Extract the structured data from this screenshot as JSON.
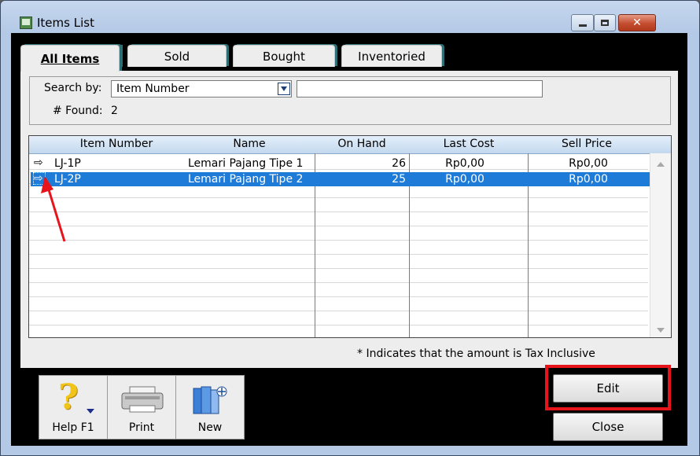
{
  "window": {
    "title": "Items List"
  },
  "tabs": [
    {
      "label": "All Items",
      "active": true
    },
    {
      "label": "Sold"
    },
    {
      "label": "Bought"
    },
    {
      "label": "Inventoried"
    }
  ],
  "search": {
    "label": "Search by:",
    "field": "Item Number",
    "value": "",
    "found_label": "# Found:",
    "found_count": "2"
  },
  "grid": {
    "columns": [
      "Item Number",
      "Name",
      "On Hand",
      "Last Cost",
      "Sell Price"
    ],
    "rows": [
      {
        "item_number": "LJ-1P",
        "name": "Lemari Pajang Tipe 1",
        "on_hand": "26",
        "last_cost": "Rp0,00",
        "sell_price": "Rp0,00",
        "selected": false
      },
      {
        "item_number": "LJ-2P",
        "name": "Lemari Pajang Tipe 2",
        "on_hand": "25",
        "last_cost": "Rp0,00",
        "sell_price": "Rp0,00",
        "selected": true
      }
    ]
  },
  "note": "* Indicates that the amount is Tax Inclusive",
  "toolbar": {
    "help_label": "Help F1",
    "print_label": "Print",
    "new_label": "New"
  },
  "buttons": {
    "edit_label": "Edit",
    "close_label": "Close"
  },
  "colors": {
    "selection": "#1e7bd7",
    "highlight": "#e8141b",
    "tab_accent": "#2e6f75"
  },
  "icons": {
    "help": "question-mark-icon",
    "print": "printer-icon",
    "new": "new-item-icon",
    "row": "arrow-right-icon"
  }
}
